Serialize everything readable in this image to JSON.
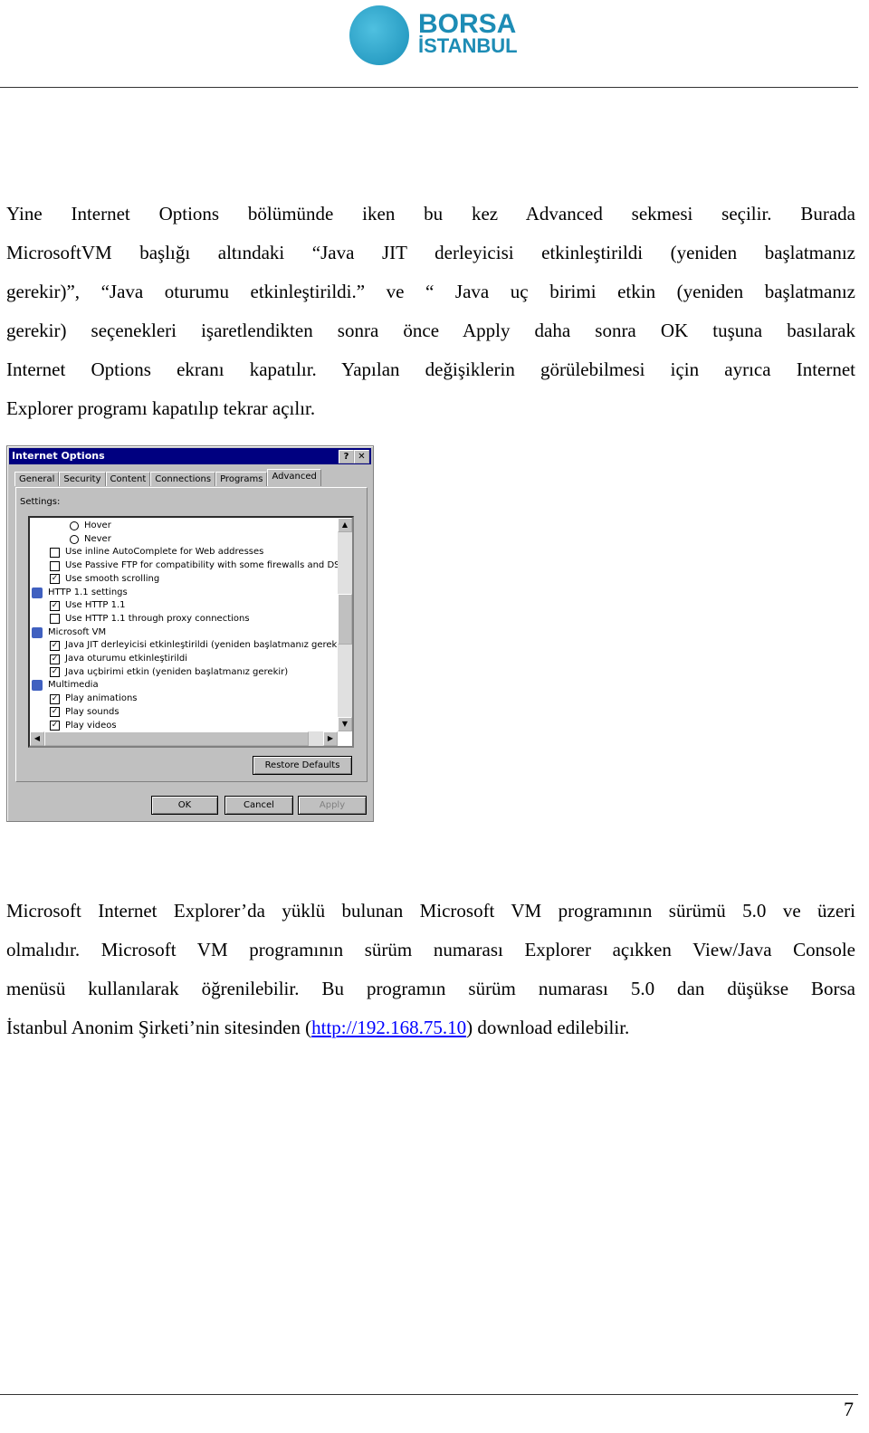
{
  "header": {
    "logo_line1": "BORSA",
    "logo_line2": "İSTANBUL",
    "brand_color": "#1d8cb5"
  },
  "paragraph1": [
    "Yine Internet Options bölümünde iken bu kez Advanced sekmesi seçilir. Burada",
    "MicrosoftVM başlığı altındaki “Java JIT derleyicisi etkinleştirildi (yeniden başlatmanız",
    "gerekir)”, “Java oturumu etkinleştirildi.” ve “ Java uç birimi etkin (yeniden başlatmanız",
    "gerekir) seçenekleri işaretlendikten sonra önce Apply daha sonra OK  tuşuna basılarak",
    "Internet Options ekranı kapatılır. Yapılan değişiklerin görülebilmesi için ayrıca Internet",
    "Explorer programı kapatılıp tekrar açılır."
  ],
  "dialog": {
    "title": "Internet Options",
    "help": "?",
    "close": "✕",
    "tabs": [
      "General",
      "Security",
      "Content",
      "Connections",
      "Programs",
      "Advanced"
    ],
    "active_tab": "Advanced",
    "settings_label": "Settings:",
    "items": [
      {
        "type": "radio",
        "label": "Hover",
        "checked": false
      },
      {
        "type": "radio",
        "label": "Never",
        "checked": false
      },
      {
        "type": "checkbox",
        "label": "Use inline AutoComplete for Web addresses",
        "checked": false
      },
      {
        "type": "checkbox",
        "label": "Use Passive FTP for compatibility with some firewalls and DSL m",
        "checked": false
      },
      {
        "type": "checkbox",
        "label": "Use smooth scrolling",
        "checked": true
      },
      {
        "type": "group",
        "label": "HTTP 1.1 settings",
        "icon": "ie-icon"
      },
      {
        "type": "checkbox",
        "label": "Use HTTP 1.1",
        "checked": true
      },
      {
        "type": "checkbox",
        "label": "Use HTTP 1.1 through proxy connections",
        "checked": false
      },
      {
        "type": "group",
        "label": "Microsoft VM",
        "icon": "document-icon"
      },
      {
        "type": "checkbox",
        "label": "Java JIT derleyicisi etkinleştirildi (yeniden başlatmanız gerekir)",
        "checked": true
      },
      {
        "type": "checkbox",
        "label": "Java oturumu etkinleştirildi",
        "checked": true
      },
      {
        "type": "checkbox",
        "label": "Java uçbirimi etkin (yeniden başlatmanız gerekir)",
        "checked": true
      },
      {
        "type": "group",
        "label": "Multimedia",
        "icon": "multimedia-icon"
      },
      {
        "type": "checkbox",
        "label": "Play animations",
        "checked": true
      },
      {
        "type": "checkbox",
        "label": "Play sounds",
        "checked": true
      },
      {
        "type": "checkbox",
        "label": "Play videos",
        "checked": true
      }
    ],
    "restore_defaults": "Restore Defaults",
    "ok": "OK",
    "cancel": "Cancel",
    "apply": "Apply"
  },
  "paragraph2": {
    "lines": [
      "Microsoft Internet Explorer’da yüklü bulunan Microsoft VM programının sürümü 5.0 ve üzeri",
      "olmalıdır. Microsoft VM programının sürüm numarası Explorer açıkken  View/Java Console",
      "menüsü kullanılarak öğrenilebilir.  Bu programın sürüm numarası 5.0 dan düşükse Borsa"
    ],
    "last_before": "İstanbul Anonim Şirketi’nin sitesinden (",
    "link": "http://192.168.75.10",
    "last_after": ") download edilebilir."
  },
  "footer": {
    "page_number": "7"
  }
}
